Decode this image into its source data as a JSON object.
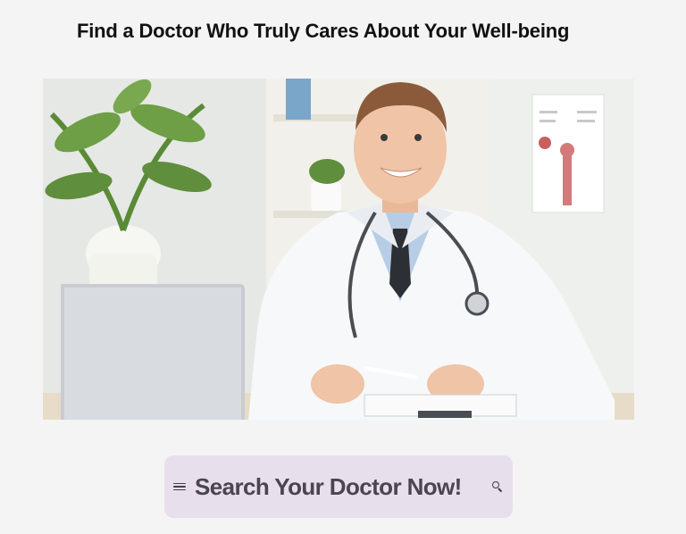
{
  "page": {
    "headline": "Find a Doctor Who Truly Cares About Your Well-being"
  },
  "hero": {
    "subject": "smiling doctor in white coat with stethoscope at desk with laptop"
  },
  "search": {
    "label": "Search Your Doctor Now!",
    "menu_icon": "menu-icon",
    "search_icon": "search-icon"
  },
  "colors": {
    "background": "#f4f4f4",
    "search_bar": "#e8dfec",
    "search_text": "#4a454f",
    "headline": "#111111"
  }
}
